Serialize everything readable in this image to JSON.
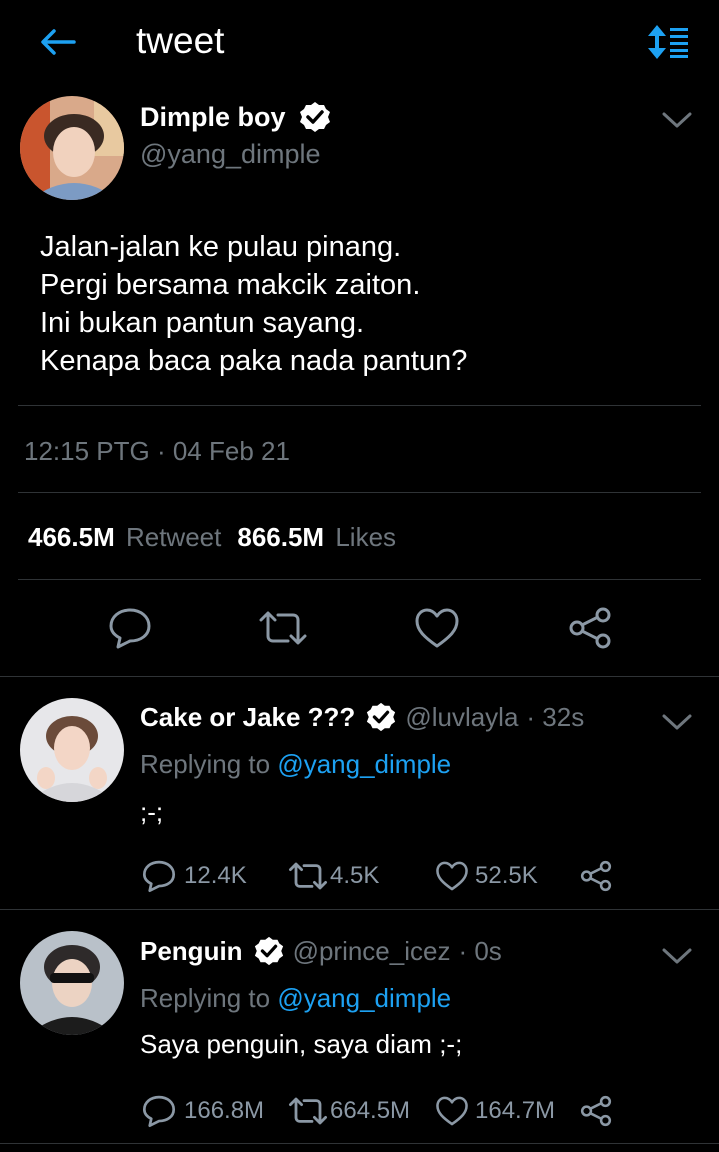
{
  "header": {
    "title": "tweet"
  },
  "main_tweet": {
    "display_name": "Dimple boy",
    "handle": "@yang_dimple",
    "text_lines": [
      "Jalan-jalan ke pulau pinang.",
      "Pergi bersama makcik zaiton.",
      "Ini bukan pantun sayang.",
      "Kenapa baca paka nada pantun?"
    ],
    "timestamp": "12:15 PTG · 04 Feb 21",
    "retweets_count": "466.5M",
    "retweets_label": "Retweet",
    "likes_count": "866.5M",
    "likes_label": "Likes"
  },
  "replies": [
    {
      "display_name": "Cake or Jake ???",
      "handle": "@luvlayla",
      "time": "· 32s",
      "replying_prefix": "Replying to",
      "replying_to": "@yang_dimple",
      "text": ";-;",
      "reply_count": "12.4K",
      "retweet_count": "4.5K",
      "like_count": "52.5K"
    },
    {
      "display_name": "Penguin",
      "handle": "@prince_icez",
      "time": "· 0s",
      "replying_prefix": "Replying to",
      "replying_to": "@yang_dimple",
      "text": "Saya penguin, saya diam ;-;",
      "reply_count": "166.8M",
      "retweet_count": "664.5M",
      "like_count": "164.7M"
    }
  ],
  "colors": {
    "background": "#000000",
    "accent": "#1da1f2",
    "muted": "#6e767d",
    "divider": "#2f3336"
  },
  "icons": [
    "back-arrow-icon",
    "sort-icon",
    "verified-badge-icon",
    "chevron-down-icon",
    "reply-icon",
    "retweet-icon",
    "like-icon",
    "share-icon"
  ]
}
